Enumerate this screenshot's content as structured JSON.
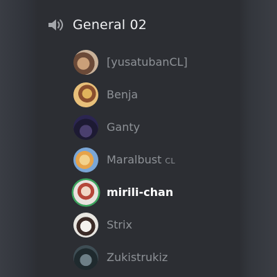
{
  "channel": {
    "name": "General 02",
    "icon": "speaker-icon"
  },
  "users": [
    {
      "name": "[yusatubanCL]",
      "tag": "",
      "avatar": "avatar",
      "speaking": false
    },
    {
      "name": "Benja",
      "tag": "",
      "avatar": "avatar",
      "speaking": false
    },
    {
      "name": "Ganty",
      "tag": "",
      "avatar": "avatar",
      "speaking": false
    },
    {
      "name": "Maralbust",
      "tag": "CL",
      "avatar": "avatar",
      "speaking": false
    },
    {
      "name": "mirili-chan",
      "tag": "",
      "avatar": "avatar",
      "speaking": true
    },
    {
      "name": "Strix",
      "tag": "",
      "avatar": "avatar",
      "speaking": false
    },
    {
      "name": "Zukistrukiz",
      "tag": "",
      "avatar": "avatar",
      "speaking": false
    }
  ],
  "colors": {
    "speaking_ring": "#3ba55d",
    "username_muted": "#8e9297",
    "username_active": "#ffffff",
    "panel_bg": "#2c2e33"
  }
}
